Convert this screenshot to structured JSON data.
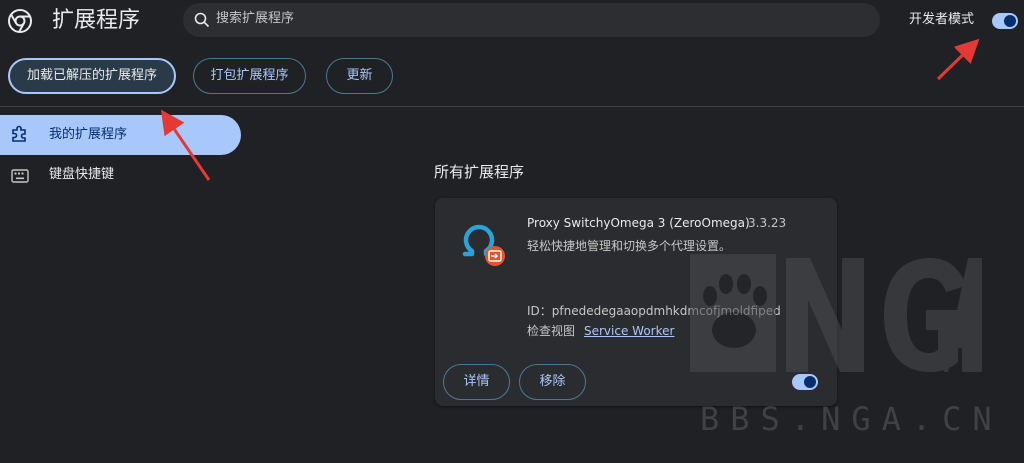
{
  "header": {
    "title": "扩展程序",
    "search_placeholder": "搜索扩展程序",
    "dev_mode_label": "开发者模式",
    "dev_mode_on": true
  },
  "toolbar": {
    "load_unpacked": "加载已解压的扩展程序",
    "pack": "打包扩展程序",
    "update": "更新"
  },
  "sidebar": {
    "items": [
      {
        "label": "我的扩展程序",
        "icon": "puzzle-icon",
        "selected": true
      },
      {
        "label": "键盘快捷键",
        "icon": "keyboard-icon",
        "selected": false
      }
    ]
  },
  "main": {
    "section_title": "所有扩展程序",
    "extension": {
      "name": "Proxy SwitchyOmega 3 (ZeroOmega)",
      "version": "3.3.23",
      "description": "轻松快捷地管理和切换多个代理设置。",
      "id_line": "ID：pfnededegaaopdmhkdmcofjmoldfiped",
      "inspect_label": "检查视图",
      "inspect_link": "Service Worker",
      "details": "详情",
      "remove": "移除",
      "enabled": true
    }
  },
  "watermark": {
    "site": "BBS.NGA.CN",
    "logo": "NGA"
  },
  "colors": {
    "accent": "#a8c7fa",
    "background": "#202124",
    "card": "#2b2c2f",
    "arrow": "#e53935"
  }
}
